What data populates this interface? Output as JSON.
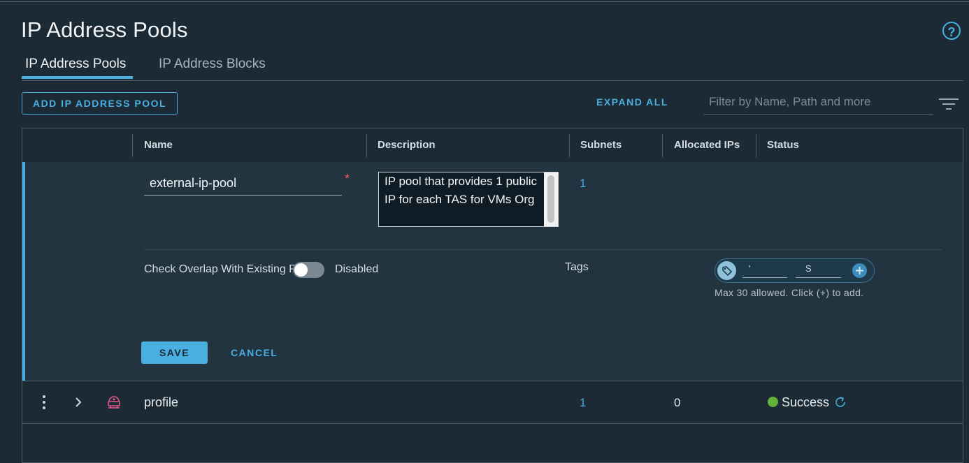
{
  "page": {
    "title": "IP Address Pools",
    "help_icon": "help-icon",
    "help_glyph": "?"
  },
  "tabs": [
    {
      "label": "IP Address Pools",
      "active": true
    },
    {
      "label": "IP Address Blocks",
      "active": false
    }
  ],
  "toolbar": {
    "add_label": "ADD IP ADDRESS POOL",
    "expand_label": "EXPAND ALL",
    "filter_placeholder": "Filter by Name, Path and more"
  },
  "table": {
    "columns": [
      "Name",
      "Description",
      "Subnets",
      "Allocated IPs",
      "Status"
    ]
  },
  "edit_row": {
    "name_value": "external-ip-pool",
    "required_mark": "*",
    "description_value": "IP pool that provides 1 public IP for each TAS for VMs Org",
    "subnets": "1",
    "overlap_label": "Check Overlap With Existing Pools",
    "overlap_state": "Disabled",
    "tags_label": "Tags",
    "tag_scope": "'",
    "tag_value": "S",
    "tags_hint": "Max 30 allowed. Click (+) to add.",
    "save_label": "SAVE",
    "cancel_label": "CANCEL"
  },
  "rows": [
    {
      "name": "profile",
      "subnets": "1",
      "allocated_ips": "0",
      "status": "Success"
    }
  ],
  "colors": {
    "background": "#1b2a35",
    "accent": "#49aee0",
    "success": "#62b13a",
    "required": "#e85b5b"
  }
}
